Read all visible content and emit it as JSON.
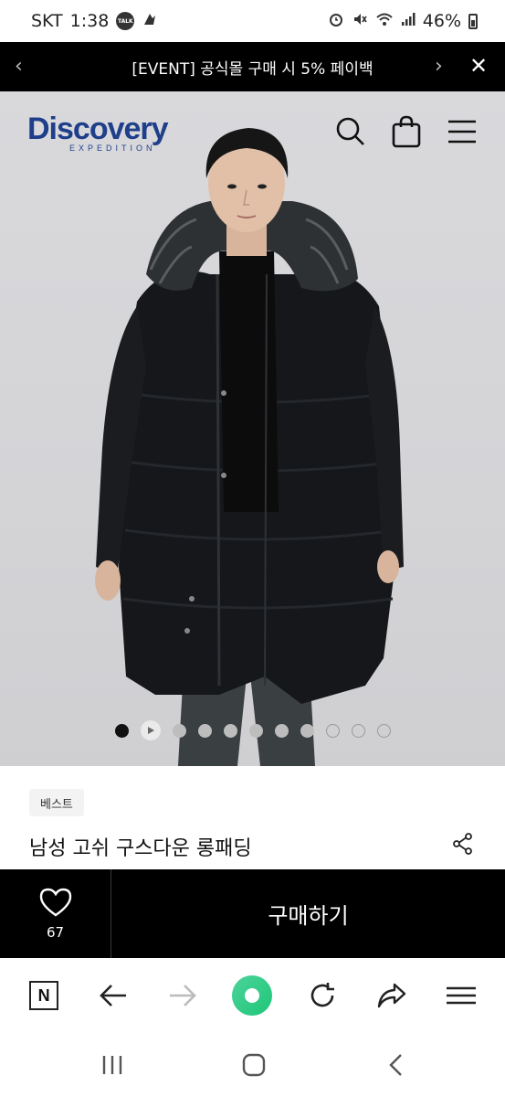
{
  "status_bar": {
    "carrier": "SKT",
    "time": "1:38",
    "talk_label": "TALK",
    "battery": "46%"
  },
  "banner": {
    "text": "[EVENT] 공식몰 구매 시 5% 페이백"
  },
  "header": {
    "brand": "Discovery",
    "brand_sub": "EXPEDITION",
    "icons": [
      "search-icon",
      "shopping-bag-icon",
      "menu-icon"
    ]
  },
  "gallery": {
    "total_slides": 11,
    "active_index": 0,
    "video_index": 1
  },
  "product": {
    "badge": "베스트",
    "title": "남성 고쉬 구스다운 롱패딩"
  },
  "purchase_bar": {
    "like_count": "67",
    "buy_label": "구매하기"
  },
  "browser_toolbar": {
    "naver_label": "N",
    "icons": [
      "naver-icon",
      "back-arrow-icon",
      "forward-arrow-icon",
      "home-icon",
      "reload-icon",
      "share-arrow-icon",
      "menu-icon"
    ]
  },
  "colors": {
    "brand_blue": "#1f3f8a",
    "banner_bg": "#000000",
    "buybar_bg": "#000000",
    "home_green": "#1ec678"
  }
}
